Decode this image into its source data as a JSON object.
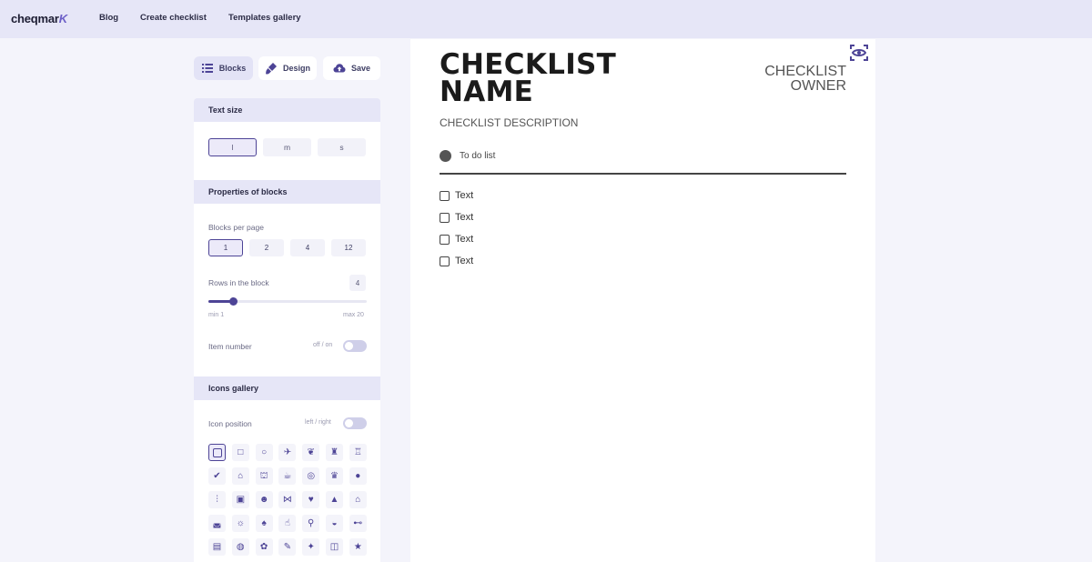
{
  "nav": {
    "logo_main": "cheqmar",
    "logo_mark": "K",
    "links": [
      "Blog",
      "Create checklist",
      "Templates gallery"
    ]
  },
  "toolbar": {
    "blocks": "Blocks",
    "design": "Design",
    "save": "Save"
  },
  "text_size": {
    "heading": "Text size",
    "options": [
      "l",
      "m",
      "s"
    ],
    "selected": "l"
  },
  "properties": {
    "heading": "Properties of blocks",
    "blocks_per_page_label": "Blocks per page",
    "blocks_per_page_options": [
      "1",
      "2",
      "4",
      "12"
    ],
    "blocks_per_page_selected": "1",
    "rows_label": "Rows in the block",
    "rows_value": "4",
    "rows_min_label": "min 1",
    "rows_max_label": "max 20",
    "rows_level": 4,
    "item_number_label": "Item number",
    "item_number_toggle_label": "off / on"
  },
  "icons_gallery": {
    "heading": "Icons gallery",
    "position_label": "Icon position",
    "position_toggle_label": "left / right",
    "icons": [
      [
        "square-rounded-icon",
        "square-icon",
        "circle-icon",
        "airplane-icon",
        "balloons-icon",
        "baby-bottle-icon",
        "cake-icon"
      ],
      [
        "check-icon",
        "hanger-icon",
        "graduation-cap-icon",
        "coffee-cup-icon",
        "ring-icon",
        "trophy-icon",
        "drop-icon"
      ],
      [
        "cutlery-icon",
        "gift-icon",
        "smile-icon",
        "bow-tie-icon",
        "heart-icon",
        "science-flask-icon",
        "home-icon"
      ],
      [
        "pot-icon",
        "sun-icon",
        "tree-icon",
        "thumbs-up-icon",
        "map-pin-icon",
        "arm-muscle-icon",
        "dumbbell-icon"
      ],
      [
        "book-icon",
        "bubble-icon",
        "palette-icon",
        "pencil-icon",
        "running-icon",
        "car-icon",
        "star-icon"
      ]
    ],
    "glyphs": [
      [
        "",
        "□",
        "○",
        "✈",
        "❦",
        "♜",
        "♖"
      ],
      [
        "✔",
        "⌂",
        "⛫",
        "☕",
        "◎",
        "♛",
        "●"
      ],
      [
        "⫶",
        "▣",
        "☻",
        "⋈",
        "♥",
        "▲",
        "⌂"
      ],
      [
        "◛",
        "☼",
        "♠",
        "☝",
        "⚲",
        "◒",
        "⊷"
      ],
      [
        "▤",
        "◍",
        "✿",
        "✎",
        "✦",
        "◫",
        "★"
      ]
    ]
  },
  "preview": {
    "title_line1": "CHECKLIST",
    "title_line2": "NAME",
    "owner_line1": "CHECKLIST",
    "owner_line2": "OWNER",
    "description": "CHECKLIST DESCRIPTION",
    "todo_label": "To do list",
    "items": [
      "Text",
      "Text",
      "Text",
      "Text"
    ]
  },
  "colors": {
    "accent": "#4d4496",
    "nav_bg": "#e6e6f7",
    "page_bg": "#f4f4fb"
  }
}
